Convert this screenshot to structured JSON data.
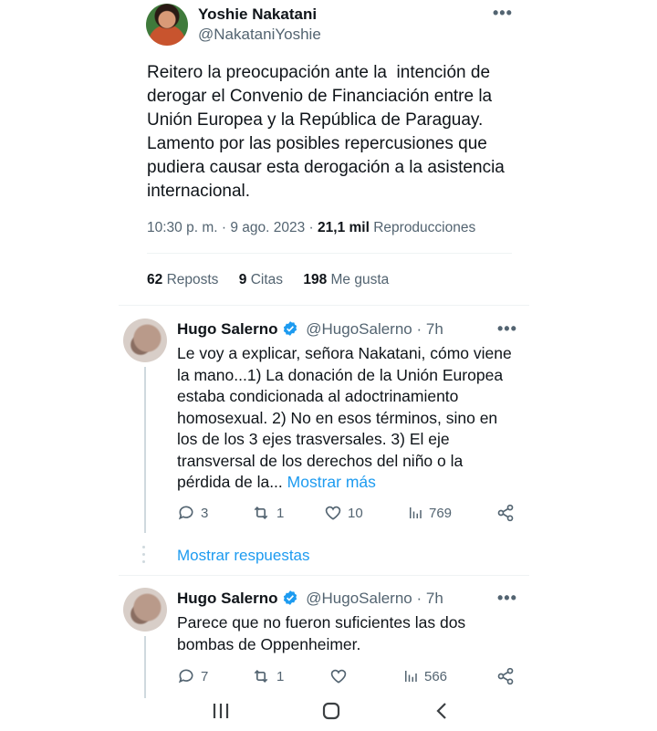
{
  "main_tweet": {
    "author_name": "Yoshie Nakatani",
    "author_handle": "@NakataniYoshie",
    "text": "Reitero la preocupación ante la  intención de derogar el Convenio de Financiación entre la Unión Europea y la República de Paraguay. Lamento por las posibles repercusiones que pudiera causar esta derogación a la asistencia internacional.",
    "lines": [
      "Reitero la preocupación ante la  intención de",
      "derogar el Convenio de Financiación entre la",
      "Unión Europea y la República de Paraguay.",
      "Lamento por las posibles repercusiones que",
      "pudiera causar esta derogación a la asistencia",
      "internacional."
    ],
    "time": "10:30 p. m.",
    "date": "9 ago. 2023",
    "sep": "·",
    "views_count": "21,1 mil",
    "views_label": "Reproducciones",
    "reposts_count": "62",
    "reposts_label": "Reposts",
    "quotes_count": "9",
    "quotes_label": "Citas",
    "likes_count": "198",
    "likes_label": "Me gusta"
  },
  "reply1": {
    "author_name": "Hugo Salerno",
    "author_handle": "@HugoSalerno",
    "age": "· 7h",
    "lines": [
      "Le voy a explicar, señora Nakatani, cómo viene",
      "la mano...1) La donación de la Unión Europea",
      "estaba condicionada al adoctrinamiento",
      "homosexual.  2) No en esos términos, sino en",
      "los de los 3 ejes trasversales.  3) El eje",
      "transversal de los derechos del niño o la"
    ],
    "last_line": "pérdida de la...",
    "show_more": "Mostrar más",
    "replies": "3",
    "reposts": "1",
    "likes": "10",
    "views": "769"
  },
  "show_replies": "Mostrar respuestas",
  "reply2": {
    "author_name": "Hugo Salerno",
    "author_handle": "@HugoSalerno",
    "age": "· 7h",
    "lines": [
      "Parece que no fueron suficientes las dos",
      "bombas de Oppenheimer."
    ],
    "replies": "7",
    "reposts": "1",
    "likes": "",
    "views": "566"
  },
  "colors": {
    "accent": "#1d9bf0",
    "muted": "#536471",
    "text": "#0f1419"
  }
}
